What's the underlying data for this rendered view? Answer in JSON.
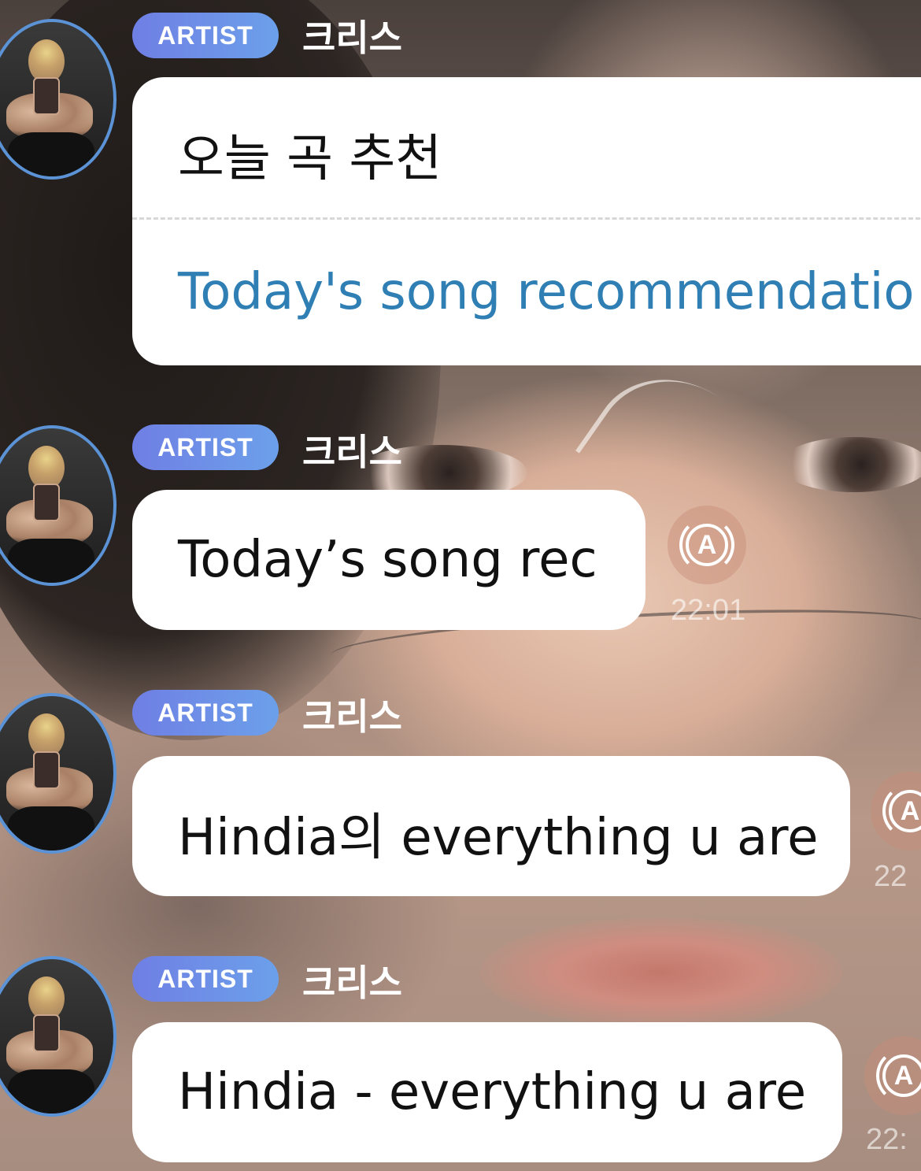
{
  "messages": [
    {
      "badge": "ARTIST",
      "sender": "크리스",
      "text": "오늘 곡 추천",
      "translation": "Today's song recommendatio"
    },
    {
      "badge": "ARTIST",
      "sender": "크리스",
      "text": "Today’s song rec",
      "translate_icon": "A",
      "time": "22:01"
    },
    {
      "badge": "ARTIST",
      "sender": "크리스",
      "text": "Hindia의 everything u are",
      "translate_icon": "A",
      "time": "22"
    },
    {
      "badge": "ARTIST",
      "sender": "크리스",
      "text": "Hindia - everything u are",
      "translate_icon": "A",
      "time": "22:"
    }
  ],
  "colors": {
    "badge_start": "#6f7fe4",
    "badge_end": "#6ca0ea",
    "avatar_ring": "#5b93d6",
    "translation_text": "#2f7fb4",
    "bubble": "#ffffff"
  },
  "icons": {
    "avatar": "avatar-photo",
    "translate": "translate-icon"
  }
}
